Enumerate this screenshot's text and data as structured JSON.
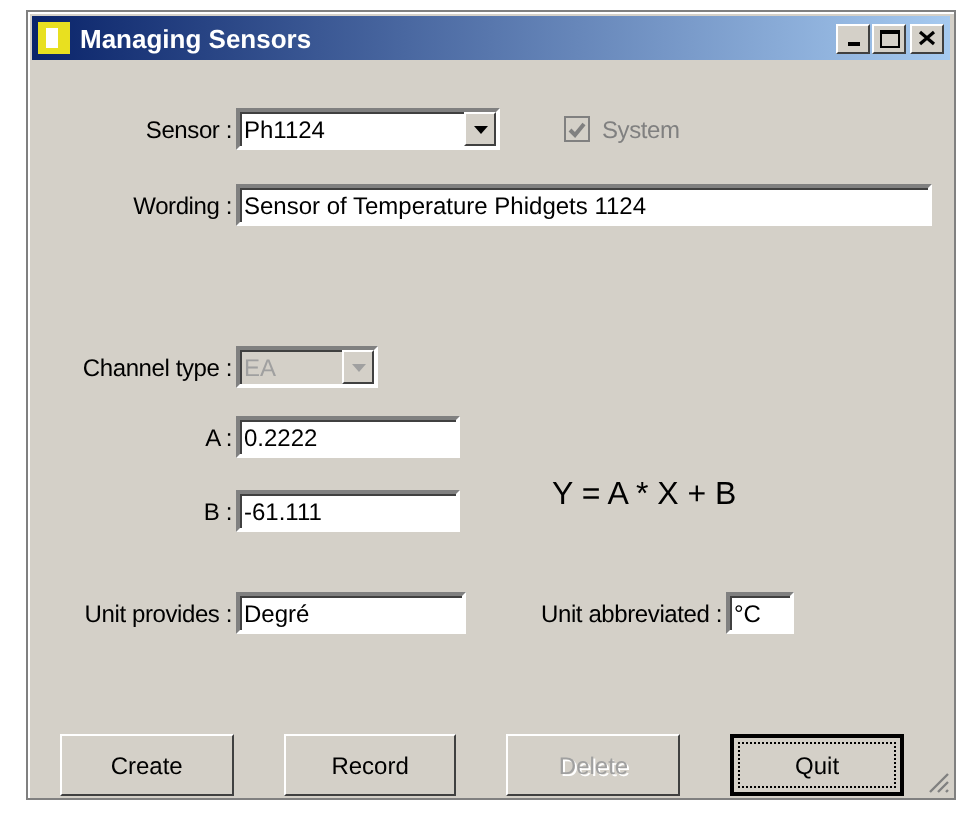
{
  "window": {
    "title": "Managing Sensors"
  },
  "sensor": {
    "label": "Sensor :",
    "value": "Ph1124"
  },
  "system": {
    "label": "System",
    "checked": true,
    "disabled": true
  },
  "wording": {
    "label": "Wording :",
    "value": "Sensor of Temperature Phidgets 1124"
  },
  "channel_type": {
    "label": "Channel type :",
    "value": "EA",
    "disabled": true
  },
  "coefficients": [
    {
      "label": "A :",
      "value": "0.2222"
    },
    {
      "label": "B :",
      "value": "-61.111"
    }
  ],
  "formula": "Y = A * X + B",
  "unit": {
    "label": "Unit provides :",
    "value": "Degré"
  },
  "unit_abbreviated": {
    "label": "Unit abbreviated :",
    "value": "°C"
  },
  "buttons": [
    {
      "label": "Create",
      "disabled": false,
      "focused": false
    },
    {
      "label": "Record",
      "disabled": false,
      "focused": false
    },
    {
      "label": "Delete",
      "disabled": true,
      "focused": false
    },
    {
      "label": "Quit",
      "disabled": false,
      "focused": true
    }
  ]
}
